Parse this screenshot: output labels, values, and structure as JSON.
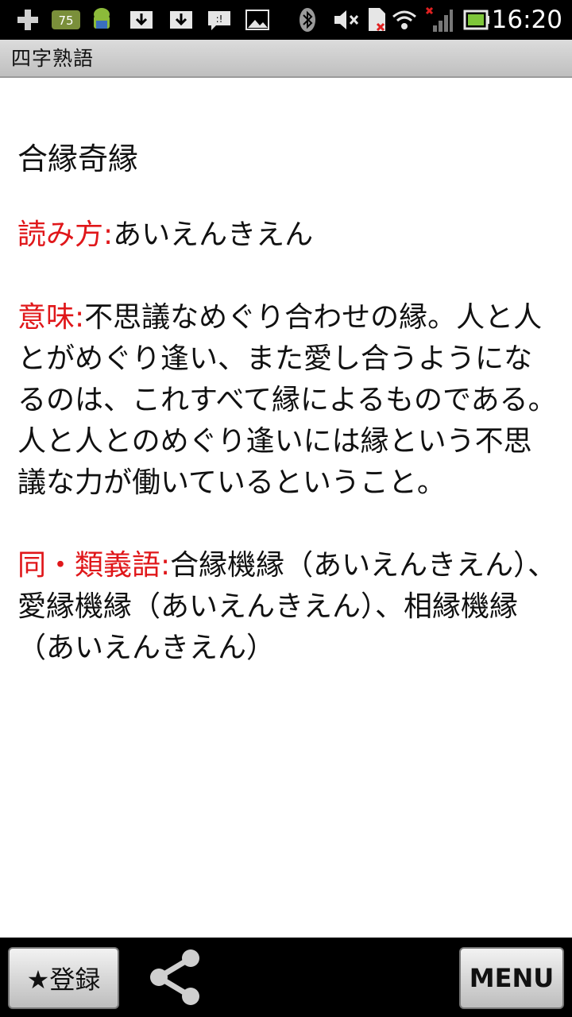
{
  "statusbar": {
    "time": "16:20",
    "badge": "75",
    "icons": [
      "add-icon",
      "battery-badge-icon",
      "android-icon",
      "download-icon",
      "download-icon",
      "message-icon",
      "image-icon",
      "bluetooth-icon",
      "mute-icon",
      "sim-icon",
      "wifi-icon",
      "signal-icon",
      "battery-icon"
    ]
  },
  "app": {
    "title": "四字熟語"
  },
  "entry": {
    "word": "合縁奇縁",
    "reading_label": "読み方:",
    "reading": "あいえんきえん",
    "meaning_label": "意味:",
    "meaning": "不思議なめぐり合わせの縁。人と人とがめぐり逢い、また愛し合うようになるのは、これすべて縁によるものである。人と人とのめぐり逢いには縁という不思議な力が働いているということ。",
    "synonyms_label": "同・類義語:",
    "synonyms": "合縁機縁（あいえんきえん）、愛縁機縁（あいえんきえん）、相縁機縁（あいえんきえん）"
  },
  "bottom": {
    "register_label": "★登録",
    "menu_label": "MENU"
  },
  "colors": {
    "label_red": "#e0171a",
    "text": "#111111"
  }
}
